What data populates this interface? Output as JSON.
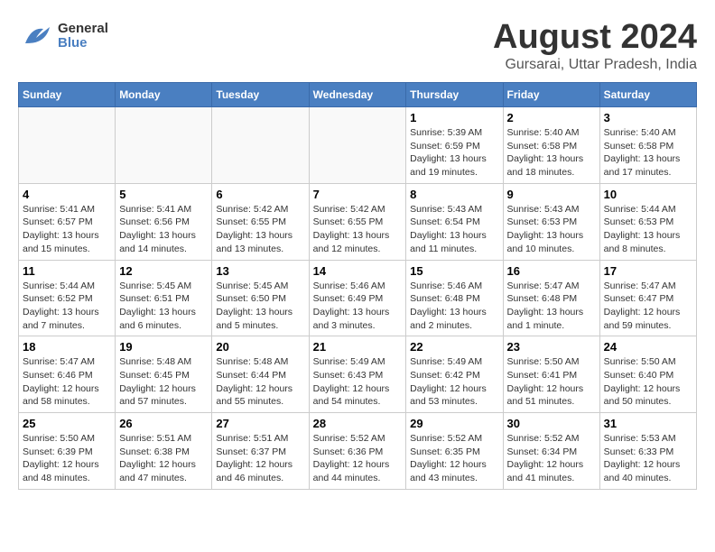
{
  "header": {
    "logo_general": "General",
    "logo_blue": "Blue",
    "month_year": "August 2024",
    "location": "Gursarai, Uttar Pradesh, India"
  },
  "days_of_week": [
    "Sunday",
    "Monday",
    "Tuesday",
    "Wednesday",
    "Thursday",
    "Friday",
    "Saturday"
  ],
  "weeks": [
    [
      {
        "day": "",
        "info": ""
      },
      {
        "day": "",
        "info": ""
      },
      {
        "day": "",
        "info": ""
      },
      {
        "day": "",
        "info": ""
      },
      {
        "day": "1",
        "info": "Sunrise: 5:39 AM\nSunset: 6:59 PM\nDaylight: 13 hours\nand 19 minutes."
      },
      {
        "day": "2",
        "info": "Sunrise: 5:40 AM\nSunset: 6:58 PM\nDaylight: 13 hours\nand 18 minutes."
      },
      {
        "day": "3",
        "info": "Sunrise: 5:40 AM\nSunset: 6:58 PM\nDaylight: 13 hours\nand 17 minutes."
      }
    ],
    [
      {
        "day": "4",
        "info": "Sunrise: 5:41 AM\nSunset: 6:57 PM\nDaylight: 13 hours\nand 15 minutes."
      },
      {
        "day": "5",
        "info": "Sunrise: 5:41 AM\nSunset: 6:56 PM\nDaylight: 13 hours\nand 14 minutes."
      },
      {
        "day": "6",
        "info": "Sunrise: 5:42 AM\nSunset: 6:55 PM\nDaylight: 13 hours\nand 13 minutes."
      },
      {
        "day": "7",
        "info": "Sunrise: 5:42 AM\nSunset: 6:55 PM\nDaylight: 13 hours\nand 12 minutes."
      },
      {
        "day": "8",
        "info": "Sunrise: 5:43 AM\nSunset: 6:54 PM\nDaylight: 13 hours\nand 11 minutes."
      },
      {
        "day": "9",
        "info": "Sunrise: 5:43 AM\nSunset: 6:53 PM\nDaylight: 13 hours\nand 10 minutes."
      },
      {
        "day": "10",
        "info": "Sunrise: 5:44 AM\nSunset: 6:53 PM\nDaylight: 13 hours\nand 8 minutes."
      }
    ],
    [
      {
        "day": "11",
        "info": "Sunrise: 5:44 AM\nSunset: 6:52 PM\nDaylight: 13 hours\nand 7 minutes."
      },
      {
        "day": "12",
        "info": "Sunrise: 5:45 AM\nSunset: 6:51 PM\nDaylight: 13 hours\nand 6 minutes."
      },
      {
        "day": "13",
        "info": "Sunrise: 5:45 AM\nSunset: 6:50 PM\nDaylight: 13 hours\nand 5 minutes."
      },
      {
        "day": "14",
        "info": "Sunrise: 5:46 AM\nSunset: 6:49 PM\nDaylight: 13 hours\nand 3 minutes."
      },
      {
        "day": "15",
        "info": "Sunrise: 5:46 AM\nSunset: 6:48 PM\nDaylight: 13 hours\nand 2 minutes."
      },
      {
        "day": "16",
        "info": "Sunrise: 5:47 AM\nSunset: 6:48 PM\nDaylight: 13 hours\nand 1 minute."
      },
      {
        "day": "17",
        "info": "Sunrise: 5:47 AM\nSunset: 6:47 PM\nDaylight: 12 hours\nand 59 minutes."
      }
    ],
    [
      {
        "day": "18",
        "info": "Sunrise: 5:47 AM\nSunset: 6:46 PM\nDaylight: 12 hours\nand 58 minutes."
      },
      {
        "day": "19",
        "info": "Sunrise: 5:48 AM\nSunset: 6:45 PM\nDaylight: 12 hours\nand 57 minutes."
      },
      {
        "day": "20",
        "info": "Sunrise: 5:48 AM\nSunset: 6:44 PM\nDaylight: 12 hours\nand 55 minutes."
      },
      {
        "day": "21",
        "info": "Sunrise: 5:49 AM\nSunset: 6:43 PM\nDaylight: 12 hours\nand 54 minutes."
      },
      {
        "day": "22",
        "info": "Sunrise: 5:49 AM\nSunset: 6:42 PM\nDaylight: 12 hours\nand 53 minutes."
      },
      {
        "day": "23",
        "info": "Sunrise: 5:50 AM\nSunset: 6:41 PM\nDaylight: 12 hours\nand 51 minutes."
      },
      {
        "day": "24",
        "info": "Sunrise: 5:50 AM\nSunset: 6:40 PM\nDaylight: 12 hours\nand 50 minutes."
      }
    ],
    [
      {
        "day": "25",
        "info": "Sunrise: 5:50 AM\nSunset: 6:39 PM\nDaylight: 12 hours\nand 48 minutes."
      },
      {
        "day": "26",
        "info": "Sunrise: 5:51 AM\nSunset: 6:38 PM\nDaylight: 12 hours\nand 47 minutes."
      },
      {
        "day": "27",
        "info": "Sunrise: 5:51 AM\nSunset: 6:37 PM\nDaylight: 12 hours\nand 46 minutes."
      },
      {
        "day": "28",
        "info": "Sunrise: 5:52 AM\nSunset: 6:36 PM\nDaylight: 12 hours\nand 44 minutes."
      },
      {
        "day": "29",
        "info": "Sunrise: 5:52 AM\nSunset: 6:35 PM\nDaylight: 12 hours\nand 43 minutes."
      },
      {
        "day": "30",
        "info": "Sunrise: 5:52 AM\nSunset: 6:34 PM\nDaylight: 12 hours\nand 41 minutes."
      },
      {
        "day": "31",
        "info": "Sunrise: 5:53 AM\nSunset: 6:33 PM\nDaylight: 12 hours\nand 40 minutes."
      }
    ]
  ]
}
